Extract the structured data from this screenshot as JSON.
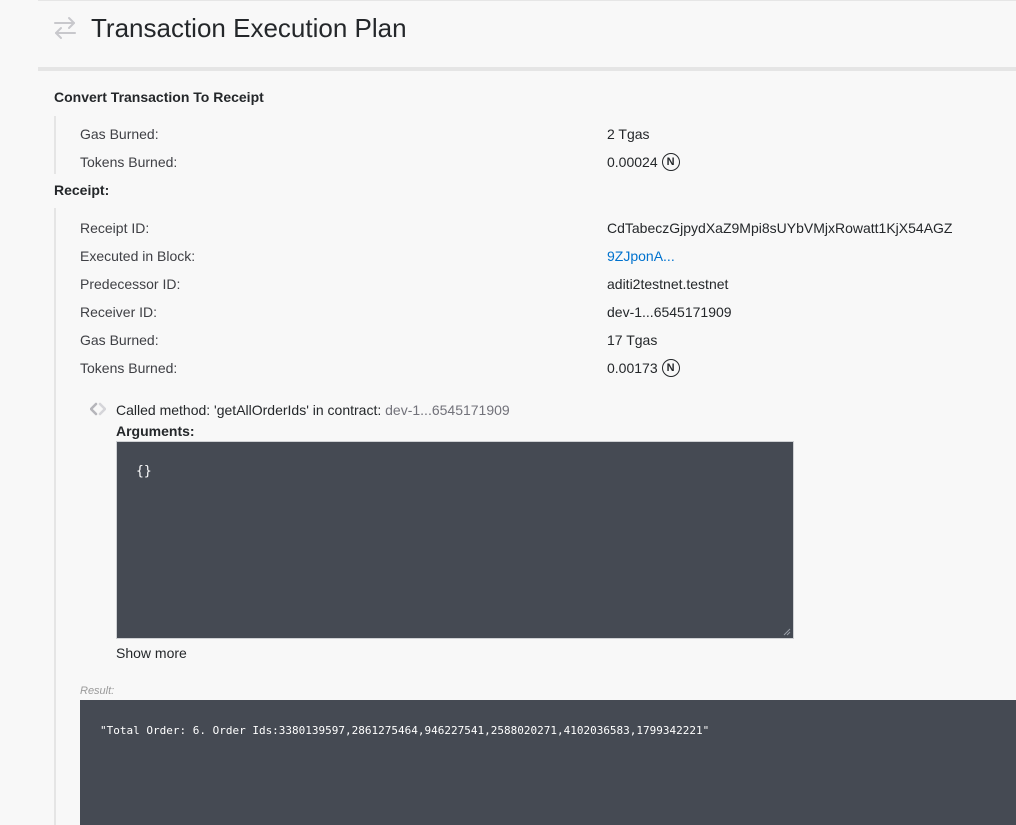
{
  "header": {
    "title": "Transaction Execution Plan",
    "icon": "transfer-arrows-icon"
  },
  "convert": {
    "title": "Convert Transaction To Receipt",
    "gas_label": "Gas Burned:",
    "gas_value": "2 Tgas",
    "tokens_label": "Tokens Burned:",
    "tokens_value": "0.00024",
    "currency_symbol": "N"
  },
  "receipt": {
    "title": "Receipt:",
    "rows": [
      {
        "label": "Receipt ID:",
        "value": "CdTabeczGjpydXaZ9Mpi8sUYbVMjxRowatt1KjX54AGZ"
      },
      {
        "label": "Executed in Block:",
        "value": "9ZJponA..."
      },
      {
        "label": "Predecessor ID:",
        "value": "aditi2testnet.testnet"
      },
      {
        "label": "Receiver ID:",
        "value": "dev-1...6545171909"
      },
      {
        "label": "Gas Burned:",
        "value": "17 Tgas"
      },
      {
        "label": "Tokens Burned:",
        "value": "0.00173"
      }
    ],
    "currency_symbol": "N"
  },
  "action": {
    "text": "Called method: 'getAllOrderIds' in contract: ",
    "contract": "dev-1...6545171909",
    "arguments_label": "Arguments:",
    "arguments_value": "{}",
    "show_more": "Show more"
  },
  "result": {
    "label": "Result:",
    "value": "\"Total Order: 6. Order Ids:3380139597,2861275464,946227541,2588020271,4102036583,1799342221\""
  },
  "colors": {
    "link": "#0072ce",
    "code_background": "#454a53",
    "page_background": "#f8f8f8"
  }
}
